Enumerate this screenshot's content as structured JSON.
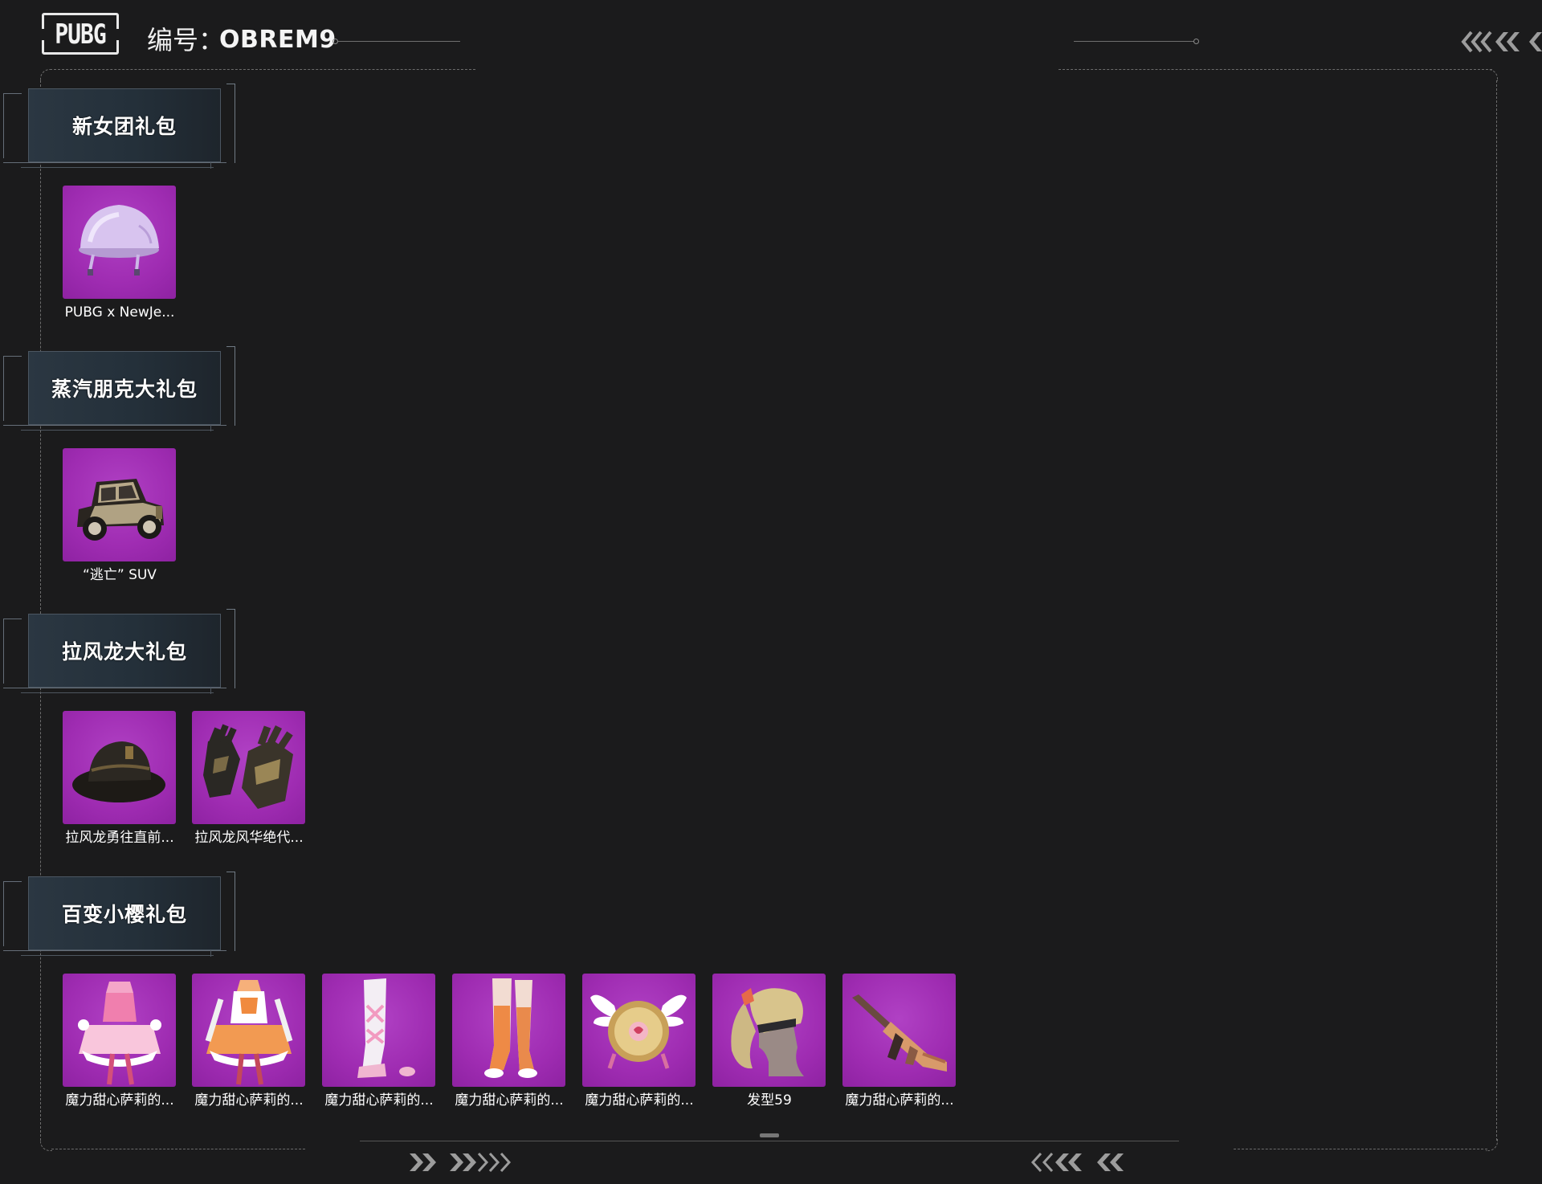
{
  "header": {
    "logo_text": "PUBG",
    "id_label": "编号：",
    "id_value": "OBREM9"
  },
  "sections": [
    {
      "title": "新女团礼包",
      "items": [
        {
          "name": "PUBG x NewJe...",
          "icon": "helmet-icon"
        }
      ]
    },
    {
      "title": "蒸汽朋克大礼包",
      "items": [
        {
          "name": "“逃亡” SUV",
          "icon": "vintage-car-icon"
        }
      ]
    },
    {
      "title": "拉风龙大礼包",
      "items": [
        {
          "name": "拉风龙勇往直前...",
          "icon": "bucket-hat-icon"
        },
        {
          "name": "拉风龙风华绝代...",
          "icon": "gloves-icon"
        }
      ]
    },
    {
      "title": "百变小樱礼包",
      "items": [
        {
          "name": "魔力甜心萨莉的...",
          "icon": "pink-dress-icon"
        },
        {
          "name": "魔力甜心萨莉的...",
          "icon": "orange-dress-icon"
        },
        {
          "name": "魔力甜心萨莉的...",
          "icon": "white-boots-icon"
        },
        {
          "name": "魔力甜心萨莉的...",
          "icon": "orange-boots-icon"
        },
        {
          "name": "魔力甜心萨莉的...",
          "icon": "winged-backpack-icon"
        },
        {
          "name": "发型59",
          "icon": "hairstyle-icon"
        },
        {
          "name": "魔力甜心萨莉的...",
          "icon": "rifle-icon"
        }
      ]
    }
  ],
  "colors": {
    "background": "#1b1b1c",
    "item_tile": "#a030b4",
    "section_panel": "#27333d",
    "frame_line": "#6c6c6c"
  }
}
